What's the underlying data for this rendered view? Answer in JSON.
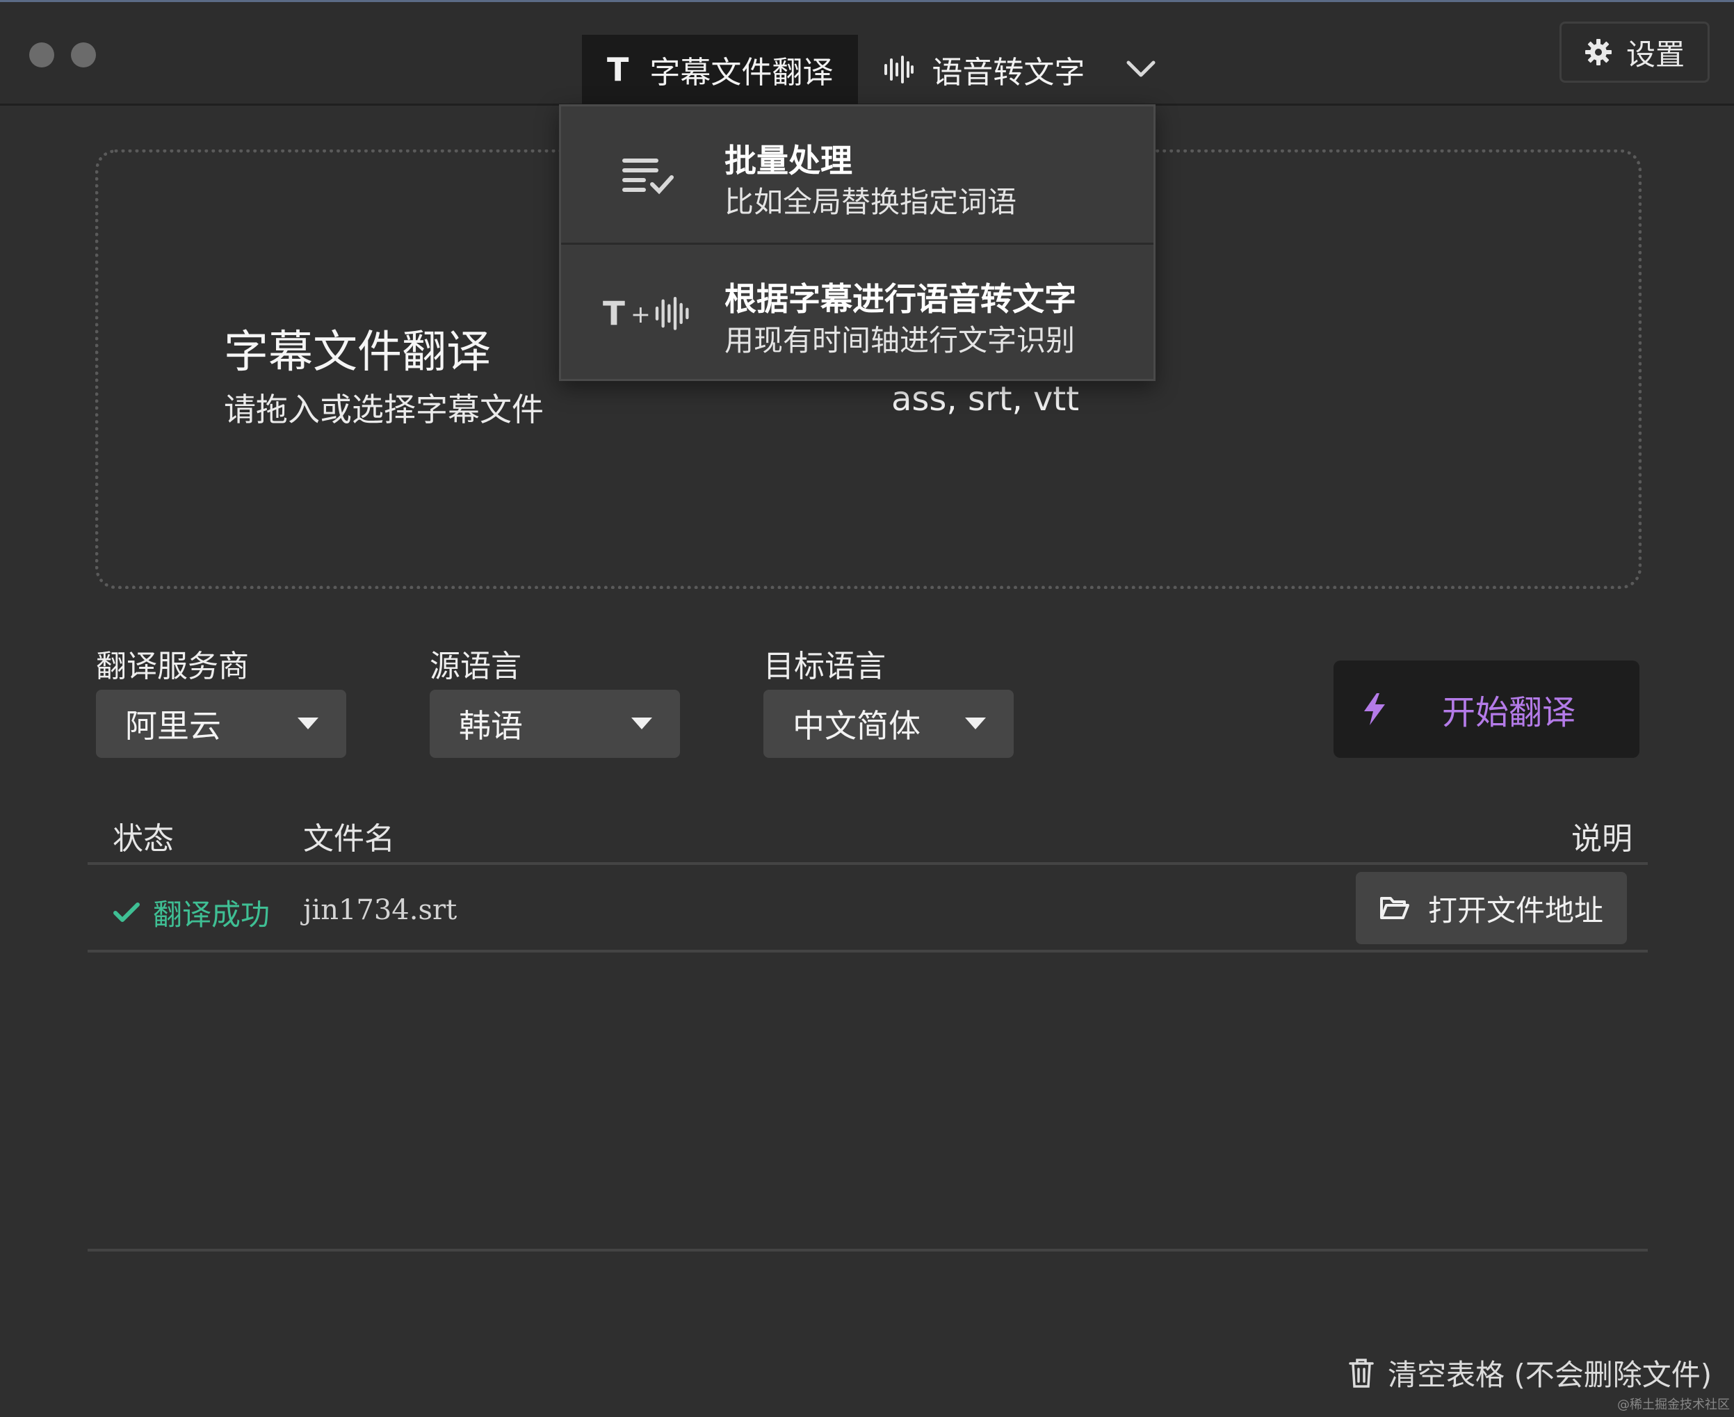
{
  "tabs": [
    {
      "label": "字幕文件翻译",
      "icon": "text-t-icon",
      "active": true
    },
    {
      "label": "语音转文字",
      "icon": "waveform-icon",
      "active": false
    }
  ],
  "settings_label": "设置",
  "menu": {
    "items": [
      {
        "title": "批量处理",
        "desc": "比如全局替换指定词语",
        "icon": "list-check-icon"
      },
      {
        "title": "根据字幕进行语音转文字",
        "desc": "用现有时间轴进行文字识别",
        "icon": "text-plus-audio-icon",
        "icon_text": "T",
        "icon_plus": "+"
      }
    ]
  },
  "dropzone": {
    "title": "字幕文件翻译",
    "subtitle": "请拖入或选择字幕文件",
    "formats": "ass, srt, vtt"
  },
  "controls": {
    "provider": {
      "label": "翻译服务商",
      "value": "阿里云"
    },
    "source": {
      "label": "源语言",
      "value": "韩语"
    },
    "target": {
      "label": "目标语言",
      "value": "中文简体"
    },
    "start_label": "开始翻译"
  },
  "table": {
    "headers": {
      "status": "状态",
      "filename": "文件名",
      "note": "说明"
    },
    "rows": [
      {
        "status": "翻译成功",
        "filename": "jin1734.srt",
        "action": "打开文件地址"
      }
    ]
  },
  "footer": {
    "clear_label": "清空表格 (不会删除文件)"
  },
  "watermark": "@稀土掘金技术社区",
  "colors": {
    "accent": "#b47be8",
    "success": "#3fbf94",
    "background": "#2f2f2f"
  }
}
